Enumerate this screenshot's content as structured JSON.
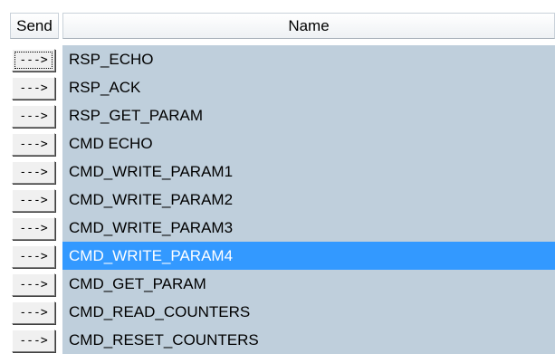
{
  "columns": {
    "send": "Send",
    "name": "Name"
  },
  "rows": [
    {
      "button_label": "--->",
      "name": "RSP_ECHO",
      "focused": true,
      "selected": false
    },
    {
      "button_label": "--->",
      "name": "RSP_ACK",
      "focused": false,
      "selected": false
    },
    {
      "button_label": "--->",
      "name": "RSP_GET_PARAM",
      "focused": false,
      "selected": false
    },
    {
      "button_label": "--->",
      "name": "CMD ECHO",
      "focused": false,
      "selected": false
    },
    {
      "button_label": "--->",
      "name": "CMD_WRITE_PARAM1",
      "focused": false,
      "selected": false
    },
    {
      "button_label": "--->",
      "name": "CMD_WRITE_PARAM2",
      "focused": false,
      "selected": false
    },
    {
      "button_label": "--->",
      "name": "CMD_WRITE_PARAM3",
      "focused": false,
      "selected": false
    },
    {
      "button_label": "--->",
      "name": "CMD_WRITE_PARAM4",
      "focused": false,
      "selected": true
    },
    {
      "button_label": "--->",
      "name": "CMD_GET_PARAM",
      "focused": false,
      "selected": false
    },
    {
      "button_label": "--->",
      "name": "CMD_READ_COUNTERS",
      "focused": false,
      "selected": false
    },
    {
      "button_label": "--->",
      "name": "CMD_RESET_COUNTERS",
      "focused": false,
      "selected": false
    }
  ],
  "colors": {
    "row_background": "#bfcfdc",
    "selection": "#3399ff",
    "button_face": "#f0f0f0"
  }
}
